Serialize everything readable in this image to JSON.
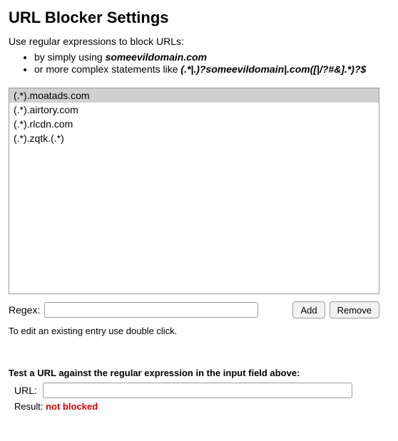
{
  "heading": "URL Blocker Settings",
  "intro": "Use regular expressions to block URLs:",
  "examples": {
    "simple_prefix": "by simply using ",
    "simple_code": "someevildomain.com",
    "complex_prefix": "or more complex statements like ",
    "complex_code": "(.*|.)?someevildomain|.com([|/?#&].*)?$"
  },
  "list_items": [
    "(.*).moatads.com",
    "(.*).airtory.com",
    "(.*).rlcdn.com",
    "(.*).zqtk.(.*)"
  ],
  "selected_index": 0,
  "regex_label": "Regex:",
  "regex_value": "",
  "buttons": {
    "add": "Add",
    "remove": "Remove"
  },
  "edit_hint": "To edit an existing entry use double click.",
  "test": {
    "title": "Test a URL against the regular expression in the input field above:",
    "url_label": "URL:",
    "url_value": "",
    "result_label": "Result: ",
    "result_value": "not blocked"
  }
}
